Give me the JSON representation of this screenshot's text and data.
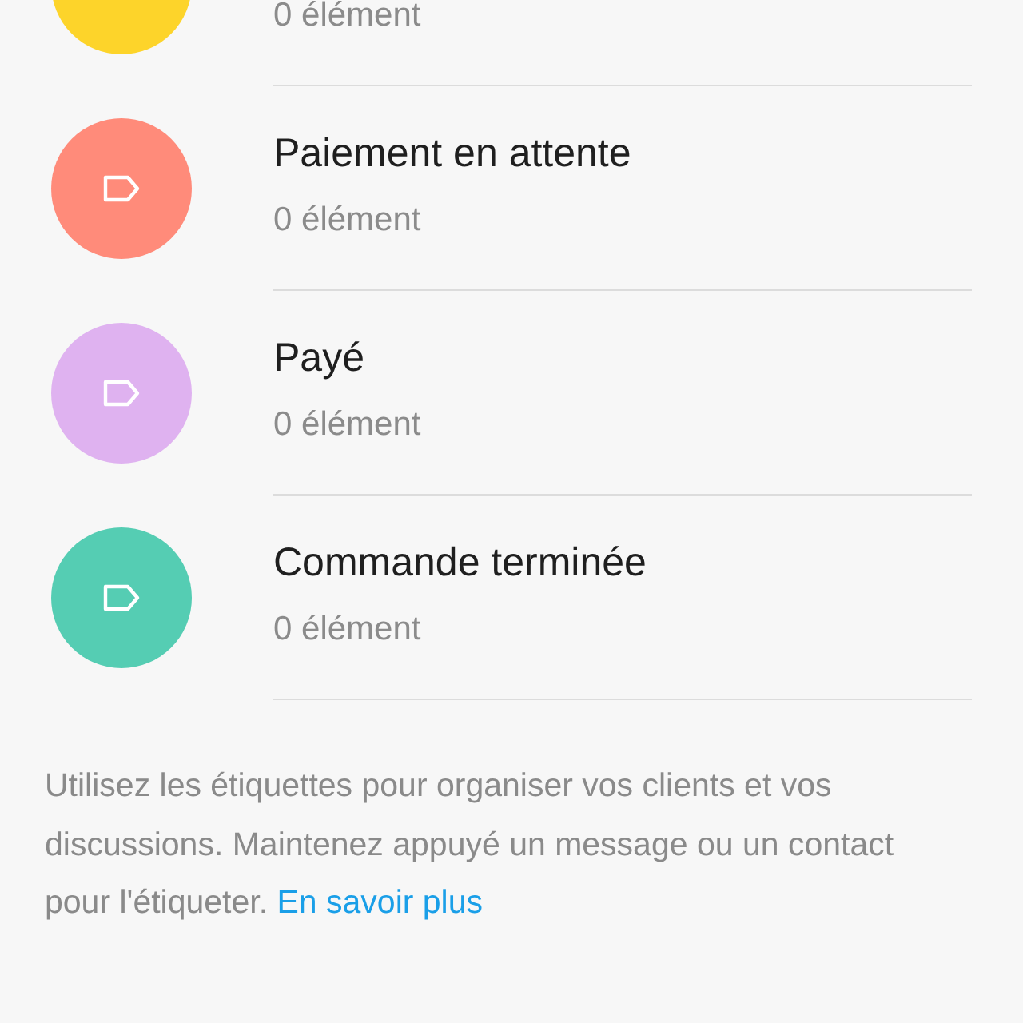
{
  "labels": [
    {
      "subtitle": "0 élément",
      "color": "#fdd42a"
    },
    {
      "title": "Paiement en attente",
      "subtitle": "0 élément",
      "color": "#ff8b7a",
      "tag_icon": true
    },
    {
      "title": "Payé",
      "subtitle": "0 élément",
      "color": "#dfb2f0",
      "tag_icon": true
    },
    {
      "title": "Commande terminée",
      "subtitle": "0 élément",
      "color": "#55cdb3",
      "tag_icon": true
    }
  ],
  "footer": {
    "text": "Utilisez les étiquettes pour organiser vos clients et vos discussions. Maintenez appuyé un message ou un contact pour l'étiqueter.",
    "link": "En savoir plus"
  }
}
